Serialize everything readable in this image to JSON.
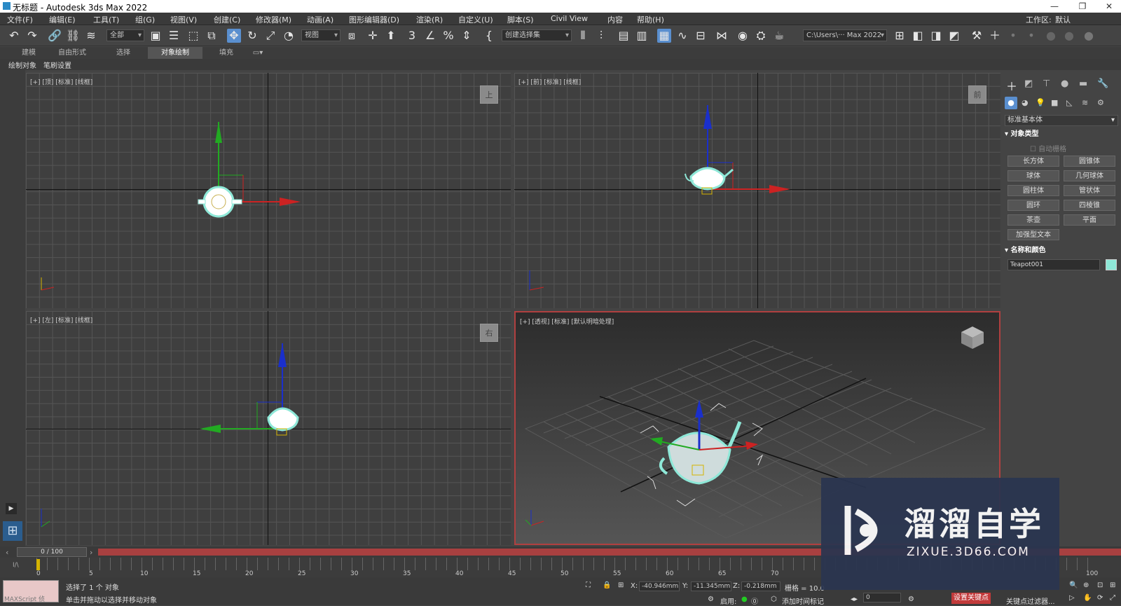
{
  "window": {
    "title": "无标题 - Autodesk 3ds Max 2022",
    "minimize": "—",
    "restore": "❐",
    "close": "✕"
  },
  "menus": [
    "文件(F)",
    "编辑(E)",
    "工具(T)",
    "组(G)",
    "视图(V)",
    "创建(C)",
    "修改器(M)",
    "动画(A)",
    "图形编辑器(D)",
    "渲染(R)",
    "自定义(U)",
    "脚本(S)",
    "Civil View",
    "内容",
    "帮助(H)"
  ],
  "workspace": {
    "label": "工作区:",
    "value": "默认"
  },
  "toolbar": {
    "filter": "全部",
    "refcoord": "视图",
    "selset": "创建选择集",
    "path": "C:\\Users\\··· Max 2022"
  },
  "ribbon_tabs": [
    "建模",
    "自由形式",
    "选择",
    "对象绘制",
    "填充"
  ],
  "subbar": [
    "绘制对象",
    "笔刷设置"
  ],
  "viewports": {
    "top": {
      "label": "[+] [顶] [标准] [线框]",
      "cube": "上"
    },
    "front": {
      "label": "[+] [前] [标准] [线框]",
      "cube": "前"
    },
    "left": {
      "label": "[+] [左] [标准] [线框]",
      "cube": "右"
    },
    "persp": {
      "label": "[+] [透视] [标准] [默认明暗处理]"
    }
  },
  "cmdpanel": {
    "category": "标准基本体",
    "object_type_title": "对象类型",
    "autogrid": "自动栅格",
    "buttons": [
      "长方体",
      "圆锥体",
      "球体",
      "几何球体",
      "圆柱体",
      "管状体",
      "圆环",
      "四棱锥",
      "茶壶",
      "平面",
      "加强型文本"
    ],
    "name_color_title": "名称和颜色",
    "object_name": "Teapot001",
    "swatch": "#8ee8d8"
  },
  "timeline": {
    "frame": "0 / 100"
  },
  "ruler": [
    "0",
    "5",
    "10",
    "15",
    "20",
    "25",
    "30",
    "35",
    "40",
    "45",
    "50",
    "55",
    "60",
    "65",
    "70",
    "100"
  ],
  "status": {
    "maxscript": "MAXScript 侦",
    "selected": "选择了 1 个 对象",
    "hint": "单击并拖动以选择并移动对象",
    "x_label": "X:",
    "x": "-40.946mm",
    "y_label": "Y:",
    "y": "-11.345mm",
    "z_label": "Z:",
    "z": "-0.218mm",
    "grid": "栅格 = 10.0",
    "enable": "启用:",
    "add_time_tag": "添加时间标记",
    "frame_input": "0",
    "set_key": "设置关键点",
    "key_filters": "关键点过滤器..."
  },
  "watermark": {
    "big": "溜溜自学",
    "small": "ZIXUE.3D66.COM"
  },
  "colors": {
    "accent": "#5a8fcf",
    "selection": "#8ee8d8",
    "x_axis": "#cc2222",
    "y_axis": "#22aa22",
    "z_axis": "#1a2fcc"
  }
}
